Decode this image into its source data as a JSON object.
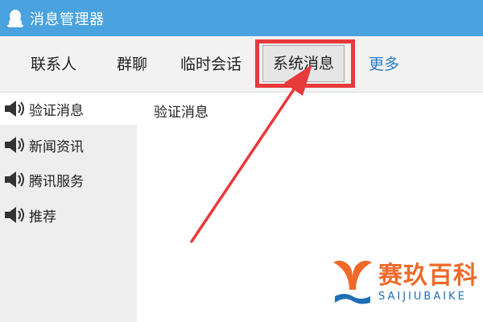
{
  "window": {
    "title": "消息管理器",
    "icon": "penguin-icon"
  },
  "tabs": [
    {
      "label": "联系人",
      "active": false
    },
    {
      "label": "群聊",
      "active": false
    },
    {
      "label": "临时会话",
      "active": false
    },
    {
      "label": "系统消息",
      "active": true
    },
    {
      "label": "更多",
      "active": false
    }
  ],
  "sidebar": {
    "items": [
      {
        "label": "验证消息",
        "icon": "speaker-icon",
        "active": true
      },
      {
        "label": "新闻资讯",
        "icon": "speaker-icon",
        "active": false
      },
      {
        "label": "腾讯服务",
        "icon": "speaker-icon",
        "active": false
      },
      {
        "label": "推荐",
        "icon": "speaker-icon",
        "active": false
      }
    ]
  },
  "content": {
    "heading": "验证消息"
  },
  "watermark": {
    "name_cn": "赛玖百科",
    "name_en": "SAIJIUBAIKE"
  },
  "colors": {
    "titlebar": "#4aa3df",
    "annotation_red": "#e8393b",
    "link_blue": "#2a7dc8",
    "watermark_orange": "#ef6a2a",
    "watermark_blue": "#1f6fb5"
  }
}
